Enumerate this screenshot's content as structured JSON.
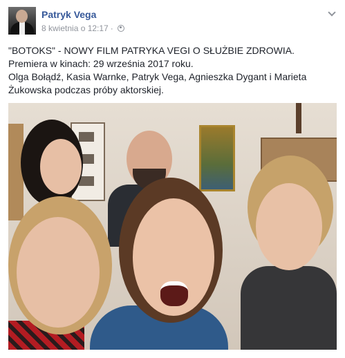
{
  "post": {
    "author": "Patryk Vega",
    "timestamp": "8 kwietnia o 12:17",
    "separator": "·",
    "privacy_icon": "globe-icon",
    "menu_icon": "chevron-down-icon",
    "text_lines": [
      "\"BOTOKS\" - NOWY FILM PATRYKA VEGI O SŁUŻBIE ZDROWIA.",
      "Premiera w kinach: 29 września 2017 roku.",
      "Olga Bołądź, Kasia Warnke, Patryk Vega, Agnieszka Dygant i Marieta",
      "Żukowska podczas próby aktorskiej."
    ]
  },
  "colors": {
    "author_link": "#365899",
    "meta_text": "#90949c",
    "body_text": "#1d2129"
  }
}
